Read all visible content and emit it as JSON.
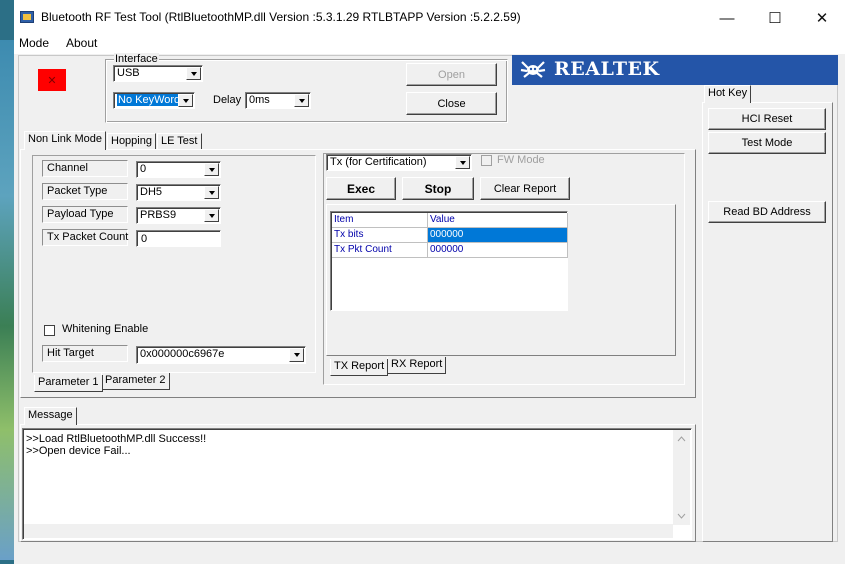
{
  "window": {
    "title": "Bluetooth RF Test Tool (RtlBluetoothMP.dll Version :5.3.1.29   RTLBTAPP Version :5.2.2.59)",
    "minimize_glyph": "—",
    "maximize_glyph": "☐",
    "close_glyph": "✕"
  },
  "menu": {
    "items": [
      "Mode",
      "About"
    ]
  },
  "status_indicator": {
    "glyph": "✕",
    "color": "#ff0000"
  },
  "interface": {
    "group_label": "Interface",
    "type_value": "USB",
    "keyword_value": "No KeyWord",
    "delay_label": "Delay",
    "delay_value": "0ms",
    "open_label": "Open",
    "close_label": "Close"
  },
  "brand": {
    "name": "REALTEK",
    "color": "#2455a8"
  },
  "main_tabs": [
    "Non Link Mode",
    "Hopping",
    "LE Test"
  ],
  "params": {
    "channel_label": "Channel",
    "channel_value": "0",
    "packet_type_label": "Packet Type",
    "packet_type_value": "DH5",
    "payload_type_label": "Payload Type",
    "payload_type_value": "PRBS9",
    "tx_count_label": "Tx Packet Count",
    "tx_count_value": "0",
    "whitening_label": "Whitening Enable",
    "hit_target_label": "Hit Target",
    "hit_target_value": "0x000000c6967e"
  },
  "param_tabs": [
    "Parameter 1",
    "Parameter 2"
  ],
  "tx": {
    "mode_value": "Tx (for Certification)",
    "fw_mode_label": "FW Mode",
    "exec_label": "Exec",
    "stop_label": "Stop",
    "clear_label": "Clear Report"
  },
  "report": {
    "columns": [
      "Item",
      "Value"
    ],
    "rows": [
      {
        "item": "Tx bits",
        "value": "000000"
      },
      {
        "item": "Tx Pkt Count",
        "value": "000000"
      }
    ]
  },
  "report_tabs": [
    "TX Report",
    "RX Report"
  ],
  "hotkey": {
    "tab_label": "Hot Key",
    "hci_reset_label": "HCI Reset",
    "test_mode_label": "Test Mode",
    "read_bd_label": "Read BD Address"
  },
  "message": {
    "tab_label": "Message",
    "lines": [
      ">>Load RtlBluetoothMP.dll Success!!",
      ">>Open device Fail..."
    ]
  }
}
